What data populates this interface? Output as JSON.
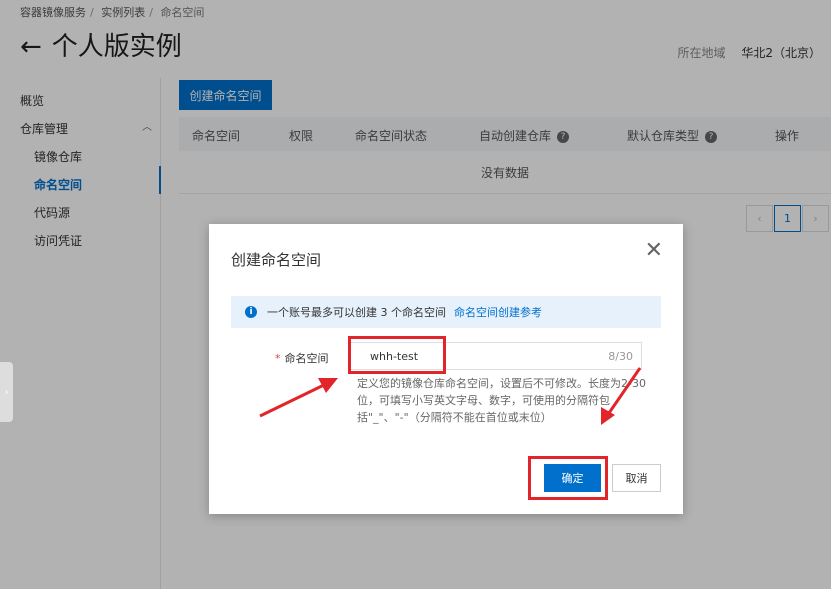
{
  "breadcrumb": [
    "容器镜像服务",
    "实例列表",
    "命名空间"
  ],
  "page_title": "个人版实例",
  "region": {
    "label": "所在地域",
    "value": "华北2（北京）"
  },
  "sidebar": {
    "items": [
      {
        "label": "概览"
      },
      {
        "label": "仓库管理"
      },
      {
        "label": "镜像仓库"
      },
      {
        "label": "命名空间"
      },
      {
        "label": "代码源"
      },
      {
        "label": "访问凭证"
      }
    ]
  },
  "toolbar": {
    "create_label": "创建命名空间"
  },
  "table": {
    "columns": [
      "命名空间",
      "权限",
      "命名空间状态",
      "自动创建仓库",
      "默认仓库类型",
      "操作"
    ],
    "empty_text": "没有数据"
  },
  "pagination": {
    "current_page": "1"
  },
  "modal": {
    "title": "创建命名空间",
    "info_text": "一个账号最多可以创建 3 个命名空间",
    "info_link": "命名空间创建参考",
    "field_label": "命名空间",
    "field_required": "*",
    "field_value": "whh-test",
    "field_count": "8/30",
    "hint": "定义您的镜像仓库命名空间，设置后不可修改。长度为2-30位，可填写小写英文字母、数字，可使用的分隔符包括\"_\"、\"-\"（分隔符不能在首位或末位）",
    "ok_label": "确定",
    "cancel_label": "取消"
  },
  "colors": {
    "accent": "#0070cc",
    "annotation_red": "#e1252a",
    "info_bg": "#e6f1fc"
  }
}
